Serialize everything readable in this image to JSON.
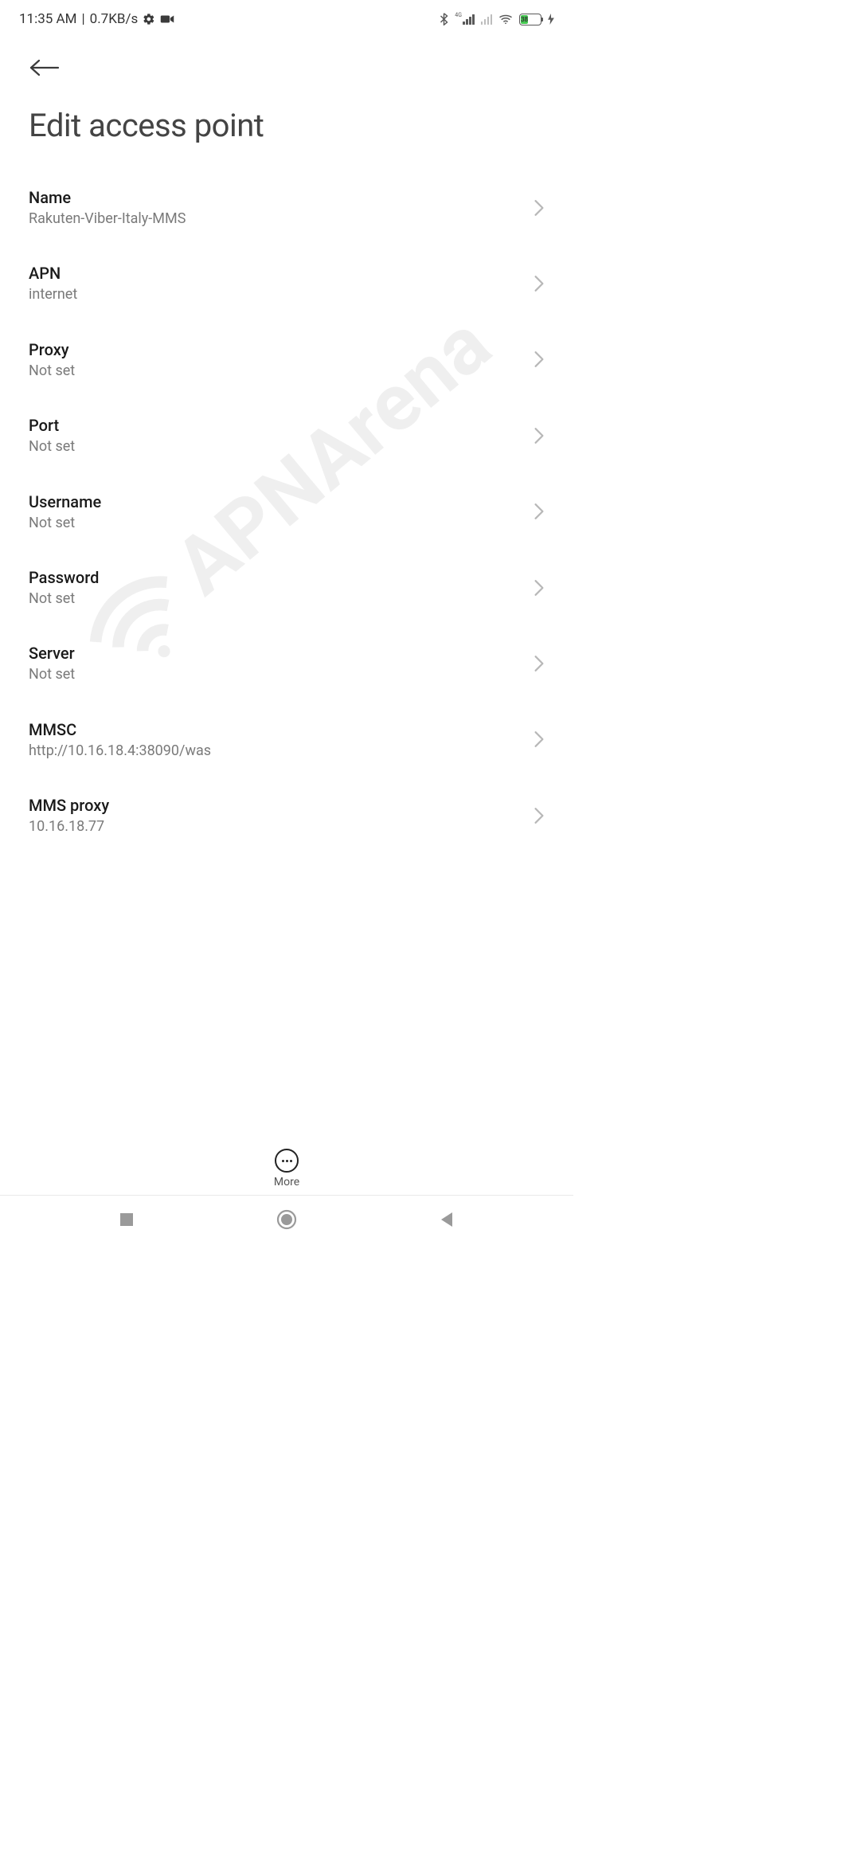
{
  "status_bar": {
    "time": "11:35 AM",
    "separator": "|",
    "network_speed": "0.7KB/s",
    "cellular_label": "4G",
    "battery_percent": "38"
  },
  "page_title": "Edit access point",
  "rows": [
    {
      "label": "Name",
      "value": "Rakuten-Viber-Italy-MMS"
    },
    {
      "label": "APN",
      "value": "internet"
    },
    {
      "label": "Proxy",
      "value": "Not set"
    },
    {
      "label": "Port",
      "value": "Not set"
    },
    {
      "label": "Username",
      "value": "Not set"
    },
    {
      "label": "Password",
      "value": "Not set"
    },
    {
      "label": "Server",
      "value": "Not set"
    },
    {
      "label": "MMSC",
      "value": "http://10.16.18.4:38090/was"
    },
    {
      "label": "MMS proxy",
      "value": "10.16.18.77"
    }
  ],
  "bottom_action": {
    "more_label": "More"
  },
  "watermark_text": "APNArena"
}
